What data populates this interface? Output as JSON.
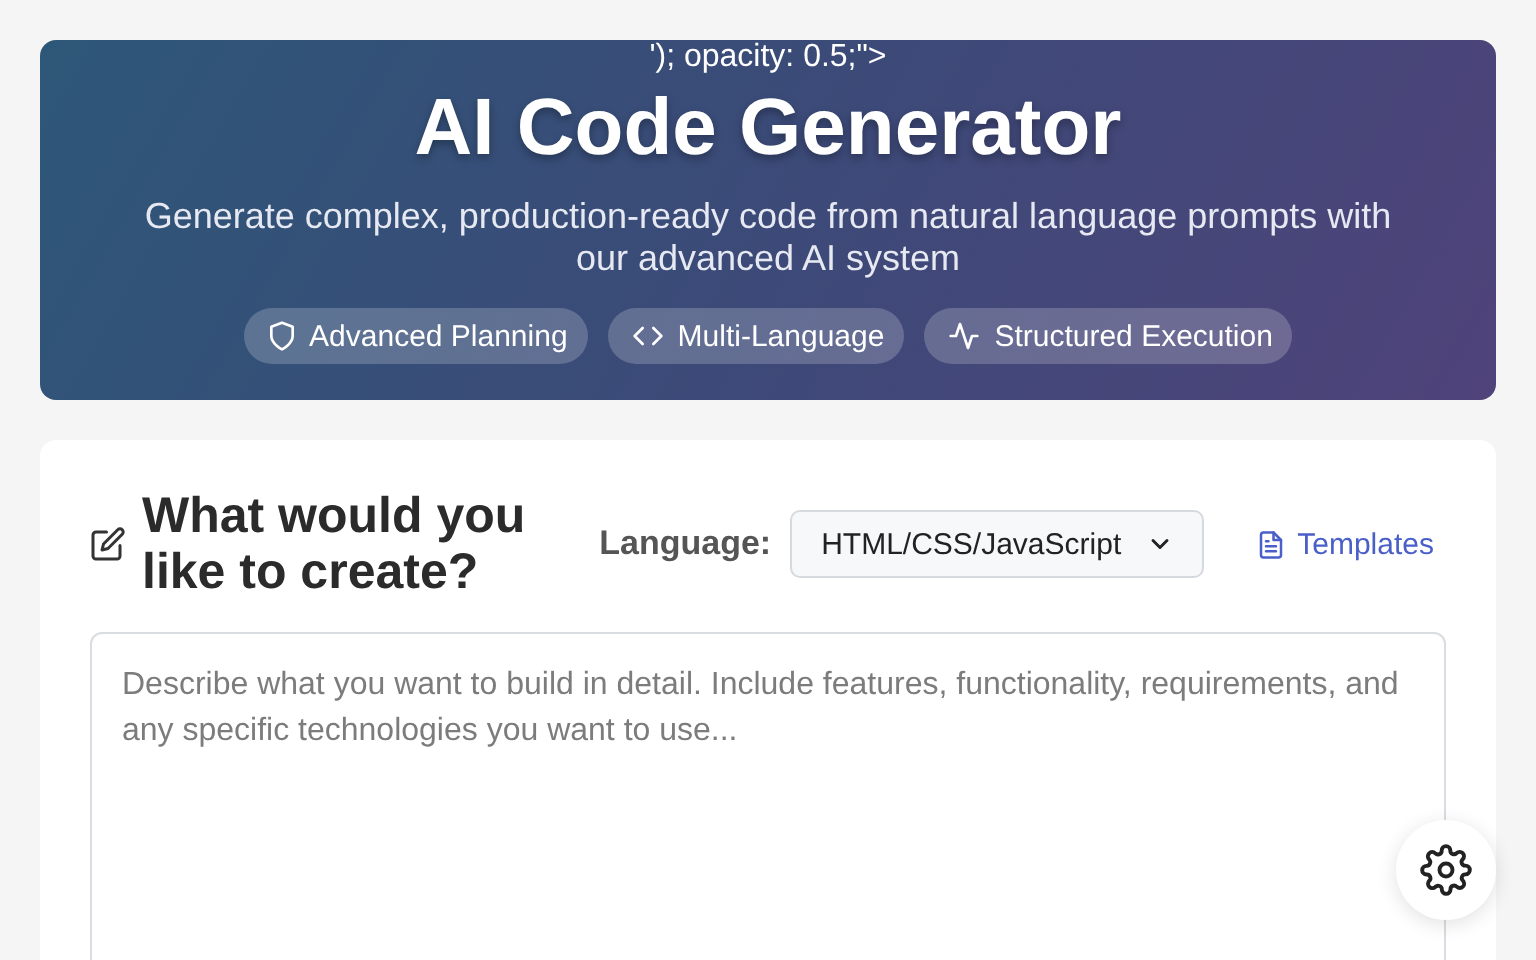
{
  "header": {
    "stray_text": "'); opacity: 0.5;\">",
    "title": "AI Code Generator",
    "subtitle": "Generate complex, production-ready code from natural language prompts with our advanced AI system",
    "badges": [
      {
        "kind": "shield",
        "label": "Advanced Planning"
      },
      {
        "kind": "code",
        "label": "Multi-Language"
      },
      {
        "kind": "activity",
        "label": "Structured Execution"
      }
    ]
  },
  "prompt_card": {
    "heading": "What would you like to create?",
    "language_label": "Language:",
    "language_value": "HTML/CSS/JavaScript",
    "templates_link": "Templates",
    "prompt_placeholder": "Describe what you want to build in detail. Include features, functionality, requirements, and any specific technologies you want to use..."
  }
}
